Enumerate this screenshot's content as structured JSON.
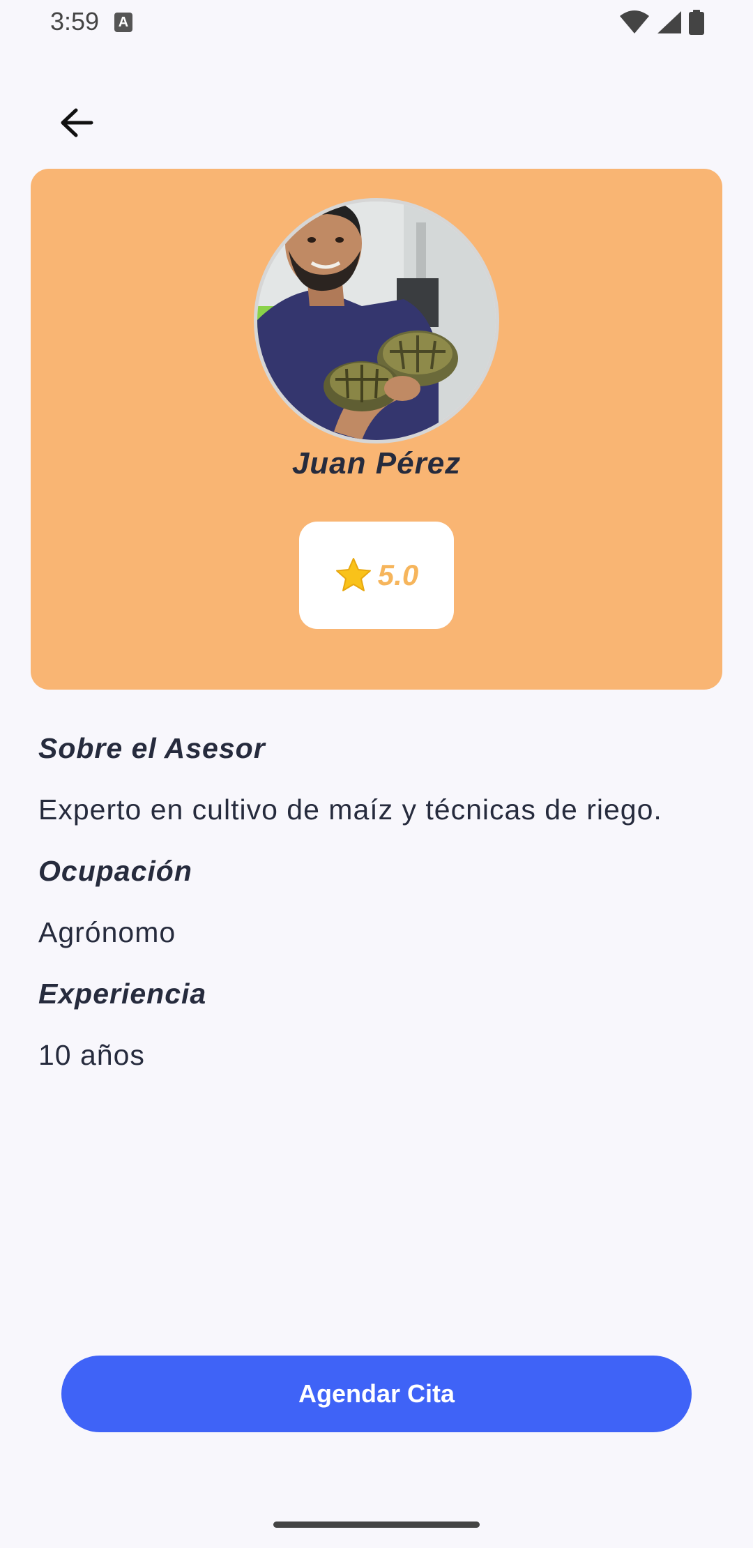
{
  "status_bar": {
    "time": "3:59",
    "notification_icon": "text-a-icon",
    "notification_letter": "A",
    "icons": [
      "wifi-icon",
      "signal-icon",
      "battery-icon"
    ]
  },
  "nav": {
    "back_icon": "arrow-left-icon"
  },
  "profile": {
    "name": "Juan Pérez",
    "photo": "advisor-photo",
    "rating_icon": "star-icon",
    "rating": "5.0",
    "card_color": "#f9b573",
    "rating_color": "#f6b55c"
  },
  "details": {
    "about_heading": "Sobre el Asesor",
    "about_text": "Experto en cultivo de maíz y técnicas de riego.",
    "occupation_heading": "Ocupación",
    "occupation_text": "Agrónomo",
    "experience_heading": "Experiencia",
    "experience_text": "10 años"
  },
  "actions": {
    "schedule_label": "Agendar Cita",
    "button_color": "#3f63f7"
  }
}
